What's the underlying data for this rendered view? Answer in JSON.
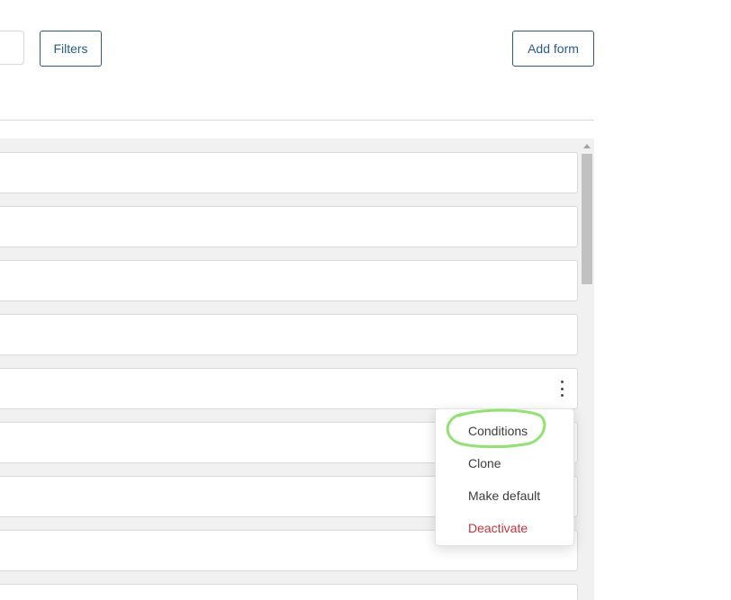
{
  "toolbar": {
    "filters_label": "Filters",
    "add_form_label": "Add form"
  },
  "list": {
    "row_count": 9,
    "active_row_index": 4
  },
  "menu": {
    "items": [
      {
        "label": "Conditions",
        "variant": "default"
      },
      {
        "label": "Clone",
        "variant": "default"
      },
      {
        "label": "Make default",
        "variant": "default"
      },
      {
        "label": "Deactivate",
        "variant": "danger"
      }
    ]
  },
  "colors": {
    "accent": "#2a5b84",
    "danger": "#c8323c",
    "highlight_marker": "#8fe36e",
    "panel_bg": "#f1f1f1"
  },
  "icons": {
    "row_actions": "kebab-vertical-icon",
    "scroll_up": "triangle-up-icon"
  }
}
